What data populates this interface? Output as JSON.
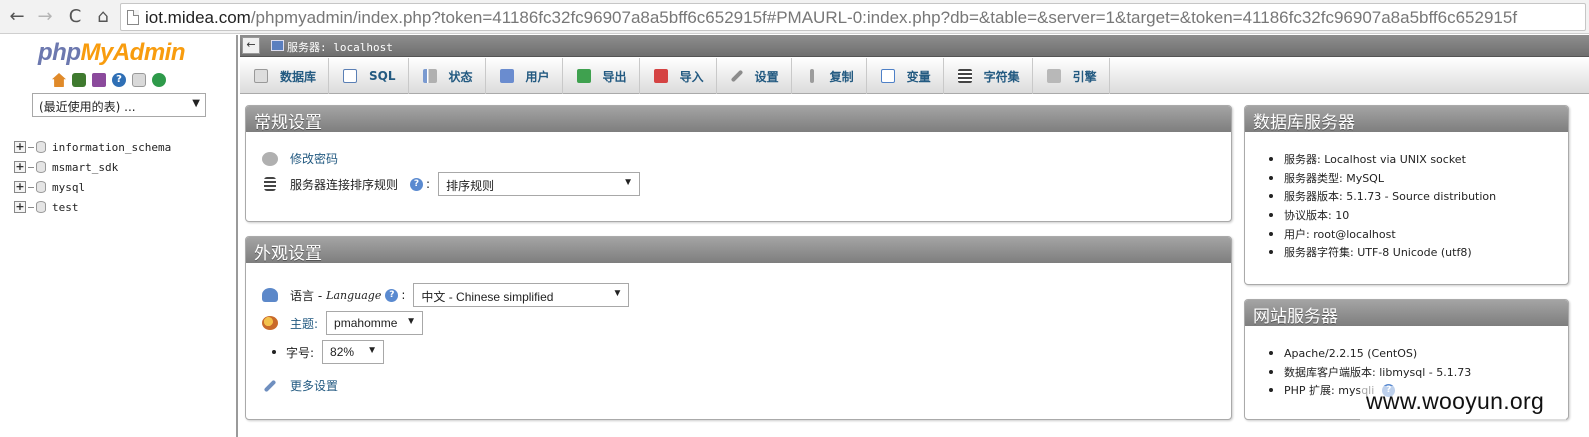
{
  "browser": {
    "back_glyph": "←",
    "forward_glyph": "→",
    "reload_glyph": "C",
    "home_glyph": "⌂",
    "url_host": "iot.midea.com",
    "url_rest": "/phpmyadmin/index.php?token=41186fc32fc96907a8a5bff6c652915f#PMAURL-0:index.php?db=&table=&server=1&target=&token=41186fc32fc96907a8a5bff6c652915f"
  },
  "sidebar": {
    "logo_php": "php",
    "logo_myadmin": "MyAdmin",
    "recent_tables": "(最近使用的表) ...",
    "databases": [
      {
        "name": "information_schema"
      },
      {
        "name": "msmart_sdk"
      },
      {
        "name": "mysql"
      },
      {
        "name": "test"
      }
    ]
  },
  "server_bar": {
    "collapse_glyph": "←",
    "label": "服务器: localhost"
  },
  "menu": {
    "tabs": [
      {
        "label": "数据库",
        "icon": "database-icon"
      },
      {
        "label": "SQL",
        "icon": "sql-icon"
      },
      {
        "label": "状态",
        "icon": "status-icon"
      },
      {
        "label": "用户",
        "icon": "users-icon"
      },
      {
        "label": "导出",
        "icon": "export-icon"
      },
      {
        "label": "导入",
        "icon": "import-icon"
      },
      {
        "label": "设置",
        "icon": "settings-icon"
      },
      {
        "label": "复制",
        "icon": "replication-icon"
      },
      {
        "label": "变量",
        "icon": "variables-icon"
      },
      {
        "label": "字符集",
        "icon": "charset-icon"
      },
      {
        "label": "引擎",
        "icon": "engines-icon"
      }
    ]
  },
  "general_settings": {
    "title": "常规设置",
    "change_password": "修改密码",
    "collation_label": "服务器连接排序规则",
    "collation_colon": ":",
    "collation_value": "排序规则"
  },
  "appearance_settings": {
    "title": "外观设置",
    "language_label": "语言 - ",
    "language_en": "Language",
    "language_colon": ":",
    "language_value": "中文 - Chinese simplified",
    "theme_label": "主题:",
    "theme_value": "pmahomme",
    "fontsize_label": "字号:",
    "fontsize_value": "82%",
    "more_settings": "更多设置"
  },
  "db_server": {
    "title": "数据库服务器",
    "items": [
      "服务器: Localhost via UNIX socket",
      "服务器类型: MySQL",
      "服务器版本: 5.1.73 - Source distribution",
      "协议版本: 10",
      "用户: root@localhost",
      "服务器字符集: UTF-8 Unicode (utf8)"
    ]
  },
  "web_server": {
    "title": "网站服务器",
    "items": [
      "Apache/2.2.15 (CentOS)",
      "数据库客户端版本: libmysql - 5.1.73",
      "PHP 扩展: mysqli"
    ]
  },
  "watermark": "www.wooyun.org",
  "help_glyph": "?",
  "select_arrow": "▼"
}
